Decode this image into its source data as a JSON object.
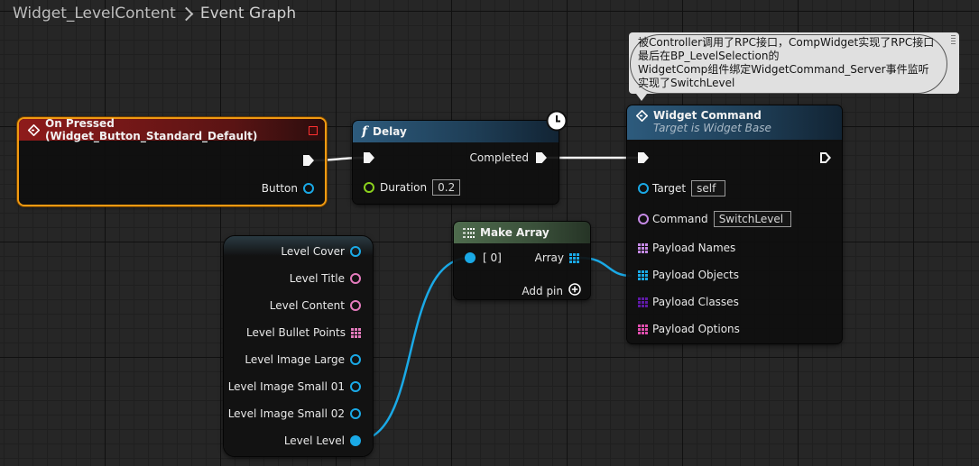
{
  "breadcrumb": {
    "parent": "Widget_LevelContent",
    "current": "Event Graph"
  },
  "comment": {
    "lines": [
      "被Controller调用了RPC接口，CompWidget实现了RPC接口",
      "最后在BP_LevelSelection的",
      "WidgetComp组件绑定WidgetCommand_Server事件监听",
      "实现了SwitchLevel"
    ]
  },
  "nodes": {
    "on_pressed": {
      "title": "On Pressed (Widget_Button_Standard_Default)",
      "button_pin": "Button"
    },
    "delay": {
      "title": "Delay",
      "completed_pin": "Completed",
      "duration_pin": "Duration",
      "duration_value": "0.2"
    },
    "widget_command": {
      "title": "Widget Command",
      "subtitle": "Target is Widget Base",
      "target_pin": "Target",
      "target_value": "self",
      "command_pin": "Command",
      "command_value": "SwitchLevel",
      "payload_names": "Payload Names",
      "payload_objects": "Payload Objects",
      "payload_classes": "Payload Classes",
      "payload_options": "Payload Options"
    },
    "make_array": {
      "title": "Make Array",
      "in_pin": "[ 0]",
      "out_pin": "Array",
      "add_pin": "Add pin"
    },
    "break_struct": {
      "pins": [
        "Level Cover",
        "Level Title",
        "Level Content",
        "Level Bullet Points",
        "Level Image Large",
        "Level Image Small 01",
        "Level Image Small 02",
        "Level Level"
      ]
    }
  },
  "colors": {
    "event_header": "#8e1b1b",
    "function_header": "#2d5b7d",
    "make_array_header": "#4e6b4d",
    "exec": "#f4f4f4",
    "object_pin": "#1aa9e6",
    "text_pin": "#e47bbd",
    "float_pin": "#8bd11d",
    "name_pin": "#c68ae6",
    "class_pin": "#5f1aa6",
    "selection": "#f09a12"
  }
}
